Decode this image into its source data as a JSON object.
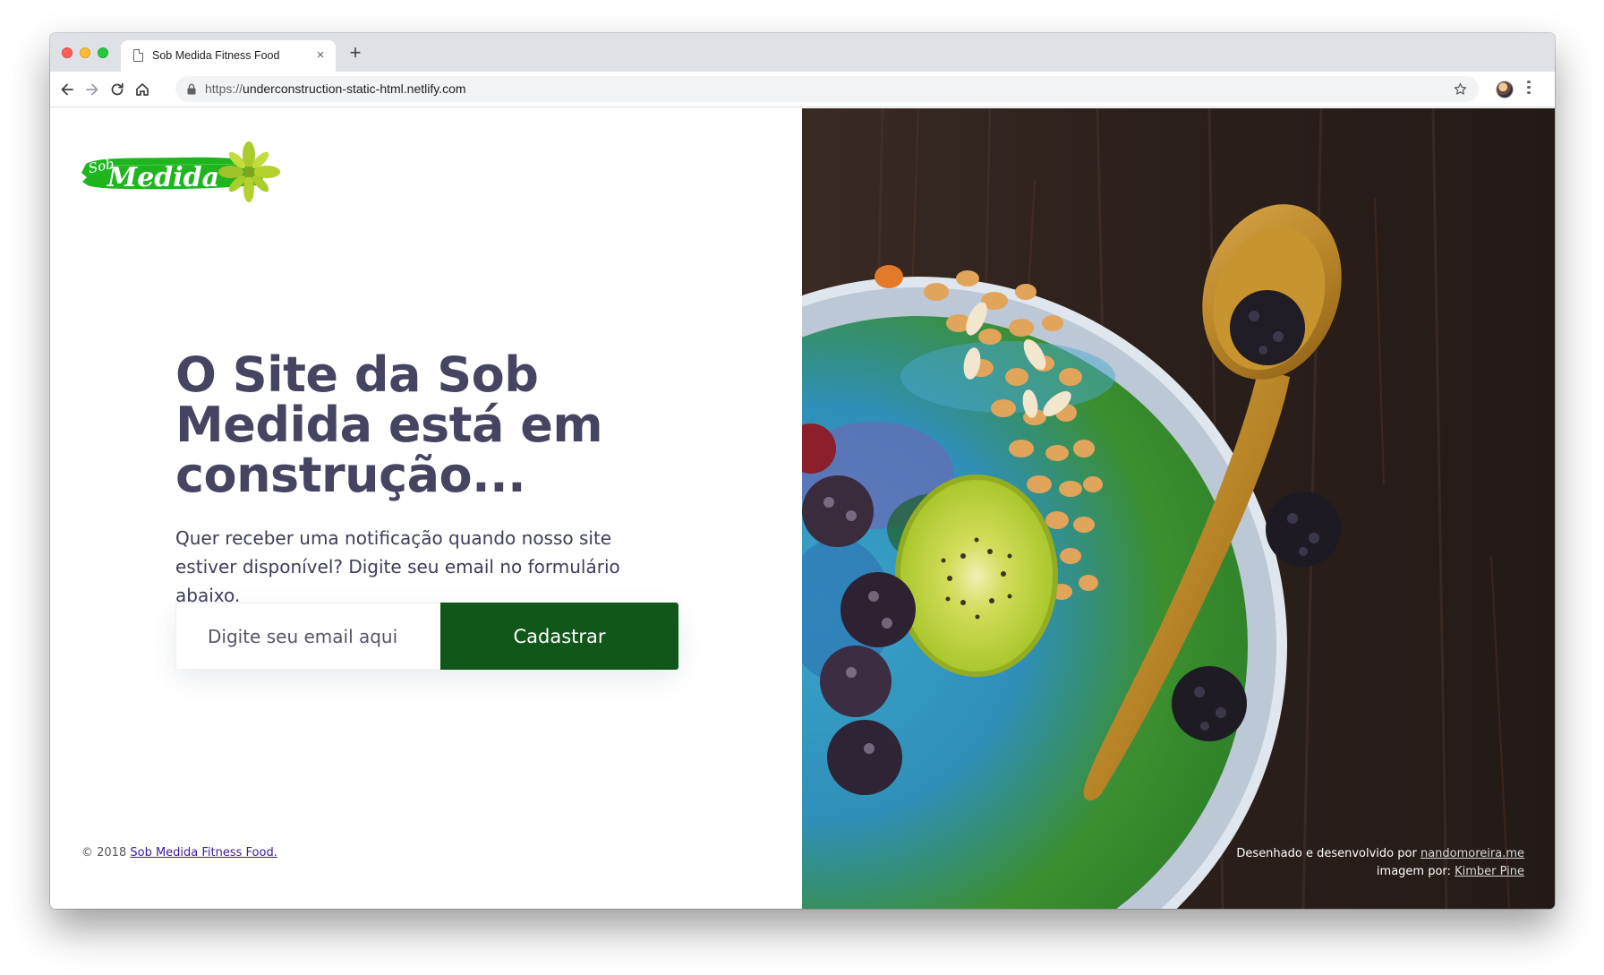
{
  "browser": {
    "tab_title": "Sob Medida Fitness Food",
    "tab_close": "×",
    "new_tab": "+",
    "url_scheme": "https://",
    "url_host": "underconstruction-static-html.netlify.com"
  },
  "page": {
    "logo_text_sob": "Sob",
    "logo_text_medida": "Medida",
    "headline": "O Site da Sob Medida está em construção...",
    "subtext": "Quer receber uma notificação quando nosso site estiver disponível? Digite seu email no formulário abaixo.",
    "email_placeholder": "Digite seu email aqui",
    "submit_label": "Cadastrar",
    "footer_copyright": "© 2018",
    "footer_link": "Sob Medida Fitness Food.",
    "credit_designed_prefix": "Desenhado e desenvolvido por",
    "credit_designed_link": "nandomoreira.me",
    "credit_image_prefix": "imagem por:",
    "credit_image_link": "Kimber Pine"
  },
  "colors": {
    "brand_green": "#11571a",
    "logo_green": "#1fb51f",
    "leaf_yellow": "#b5d12e",
    "heading": "#454562"
  },
  "icons": [
    "page-icon",
    "close-icon",
    "plus-icon",
    "back-arrow-icon",
    "forward-arrow-icon",
    "reload-icon",
    "home-icon",
    "lock-icon",
    "star-icon",
    "profile-avatar",
    "kebab-menu-icon"
  ]
}
